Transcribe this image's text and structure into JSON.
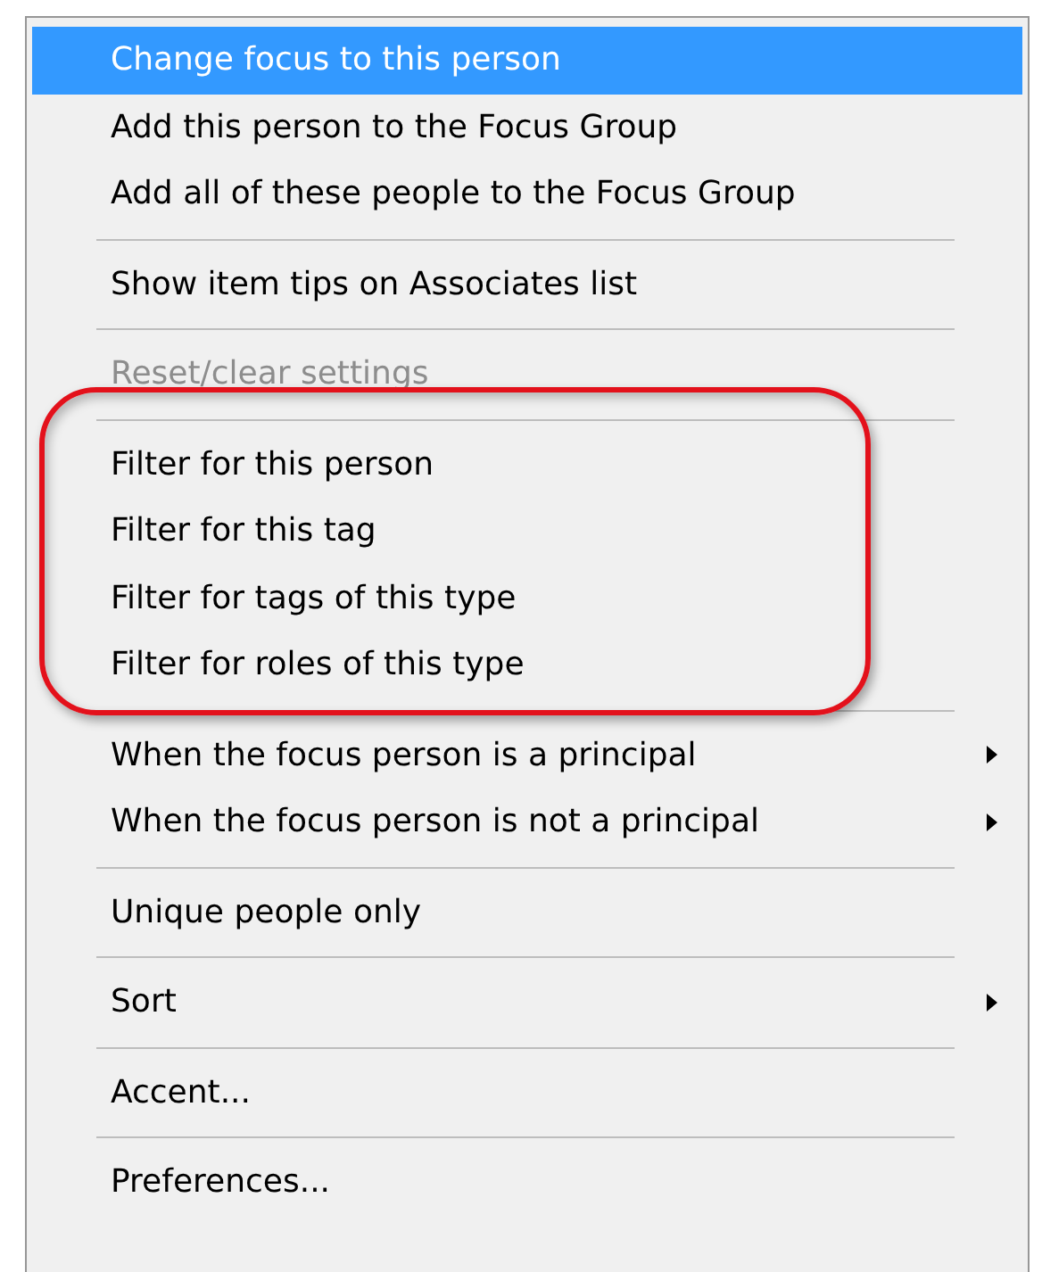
{
  "menu": {
    "sections": [
      {
        "outlined": false,
        "items": [
          {
            "label": "Change focus to this person",
            "selected": true,
            "disabled": false,
            "submenu": false
          },
          {
            "label": "Add this person to the Focus Group",
            "selected": false,
            "disabled": false,
            "submenu": false
          },
          {
            "label": "Add all of these people to the Focus Group",
            "selected": false,
            "disabled": false,
            "submenu": false
          }
        ]
      },
      {
        "outlined": false,
        "items": [
          {
            "label": "Show item tips on Associates list",
            "selected": false,
            "disabled": false,
            "submenu": false
          }
        ]
      },
      {
        "outlined": false,
        "items": [
          {
            "label": "Reset/clear settings",
            "selected": false,
            "disabled": true,
            "submenu": false
          }
        ]
      },
      {
        "outlined": true,
        "items": [
          {
            "label": "Filter for this person",
            "selected": false,
            "disabled": false,
            "submenu": false
          },
          {
            "label": "Filter for this tag",
            "selected": false,
            "disabled": false,
            "submenu": false
          },
          {
            "label": "Filter for tags of this type",
            "selected": false,
            "disabled": false,
            "submenu": false
          },
          {
            "label": "Filter for roles of this type",
            "selected": false,
            "disabled": false,
            "submenu": false
          }
        ]
      },
      {
        "outlined": false,
        "items": [
          {
            "label": "When the focus person is a principal",
            "selected": false,
            "disabled": false,
            "submenu": true
          },
          {
            "label": "When the focus person is not a principal",
            "selected": false,
            "disabled": false,
            "submenu": true
          }
        ]
      },
      {
        "outlined": false,
        "items": [
          {
            "label": "Unique people only",
            "selected": false,
            "disabled": false,
            "submenu": false
          }
        ]
      },
      {
        "outlined": false,
        "items": [
          {
            "label": "Sort",
            "selected": false,
            "disabled": false,
            "submenu": true
          }
        ]
      },
      {
        "outlined": false,
        "items": [
          {
            "label": "Accent...",
            "selected": false,
            "disabled": false,
            "submenu": false
          }
        ]
      },
      {
        "outlined": false,
        "items": [
          {
            "label": "Preferences...",
            "selected": false,
            "disabled": false,
            "submenu": false
          }
        ]
      }
    ]
  }
}
